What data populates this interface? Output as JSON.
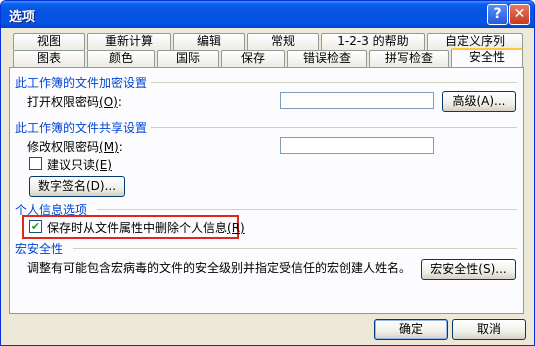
{
  "window": {
    "title": "选项",
    "help_glyph": "?",
    "close_glyph": "✕"
  },
  "tabs_back": [
    "视图",
    "重新计算",
    "编辑",
    "常规",
    "1-2-3 的帮助",
    "自定义序列"
  ],
  "tabs_front": [
    "图表",
    "颜色",
    "国际",
    "保存",
    "错误检查",
    "拼写检查",
    "安全性"
  ],
  "encryption": {
    "heading": "此工作簿的文件加密设置",
    "open_password_label": "打开权限密码",
    "open_password_key": "(O)",
    "open_password_colon": ":",
    "open_password_value": "",
    "advanced_button": "高级(A)..."
  },
  "sharing": {
    "heading": "此工作簿的文件共享设置",
    "modify_password_label": "修改权限密码",
    "modify_password_key": "(M)",
    "modify_password_colon": ":",
    "modify_password_value": "",
    "readonly_label": "建议只读",
    "readonly_key": "(E)",
    "readonly_checked": false,
    "digital_signature_button": "数字签名(D)..."
  },
  "privacy": {
    "heading": "个人信息选项",
    "remove_info_label": "保存时从文件属性中删除个人信息",
    "remove_info_key": "(R)",
    "remove_info_checked": true,
    "check_glyph": "✔"
  },
  "macro": {
    "heading": "宏安全性",
    "description": "调整有可能包含宏病毒的文件的安全级别并指定受信任的宏创建人姓名。",
    "button": "宏安全性(S)..."
  },
  "footer": {
    "ok": "确定",
    "cancel": "取消"
  },
  "colors": {
    "title_bar": "#0654e5",
    "section_heading": "#0046d5",
    "highlight": "#e0271c",
    "check": "#21a121"
  }
}
